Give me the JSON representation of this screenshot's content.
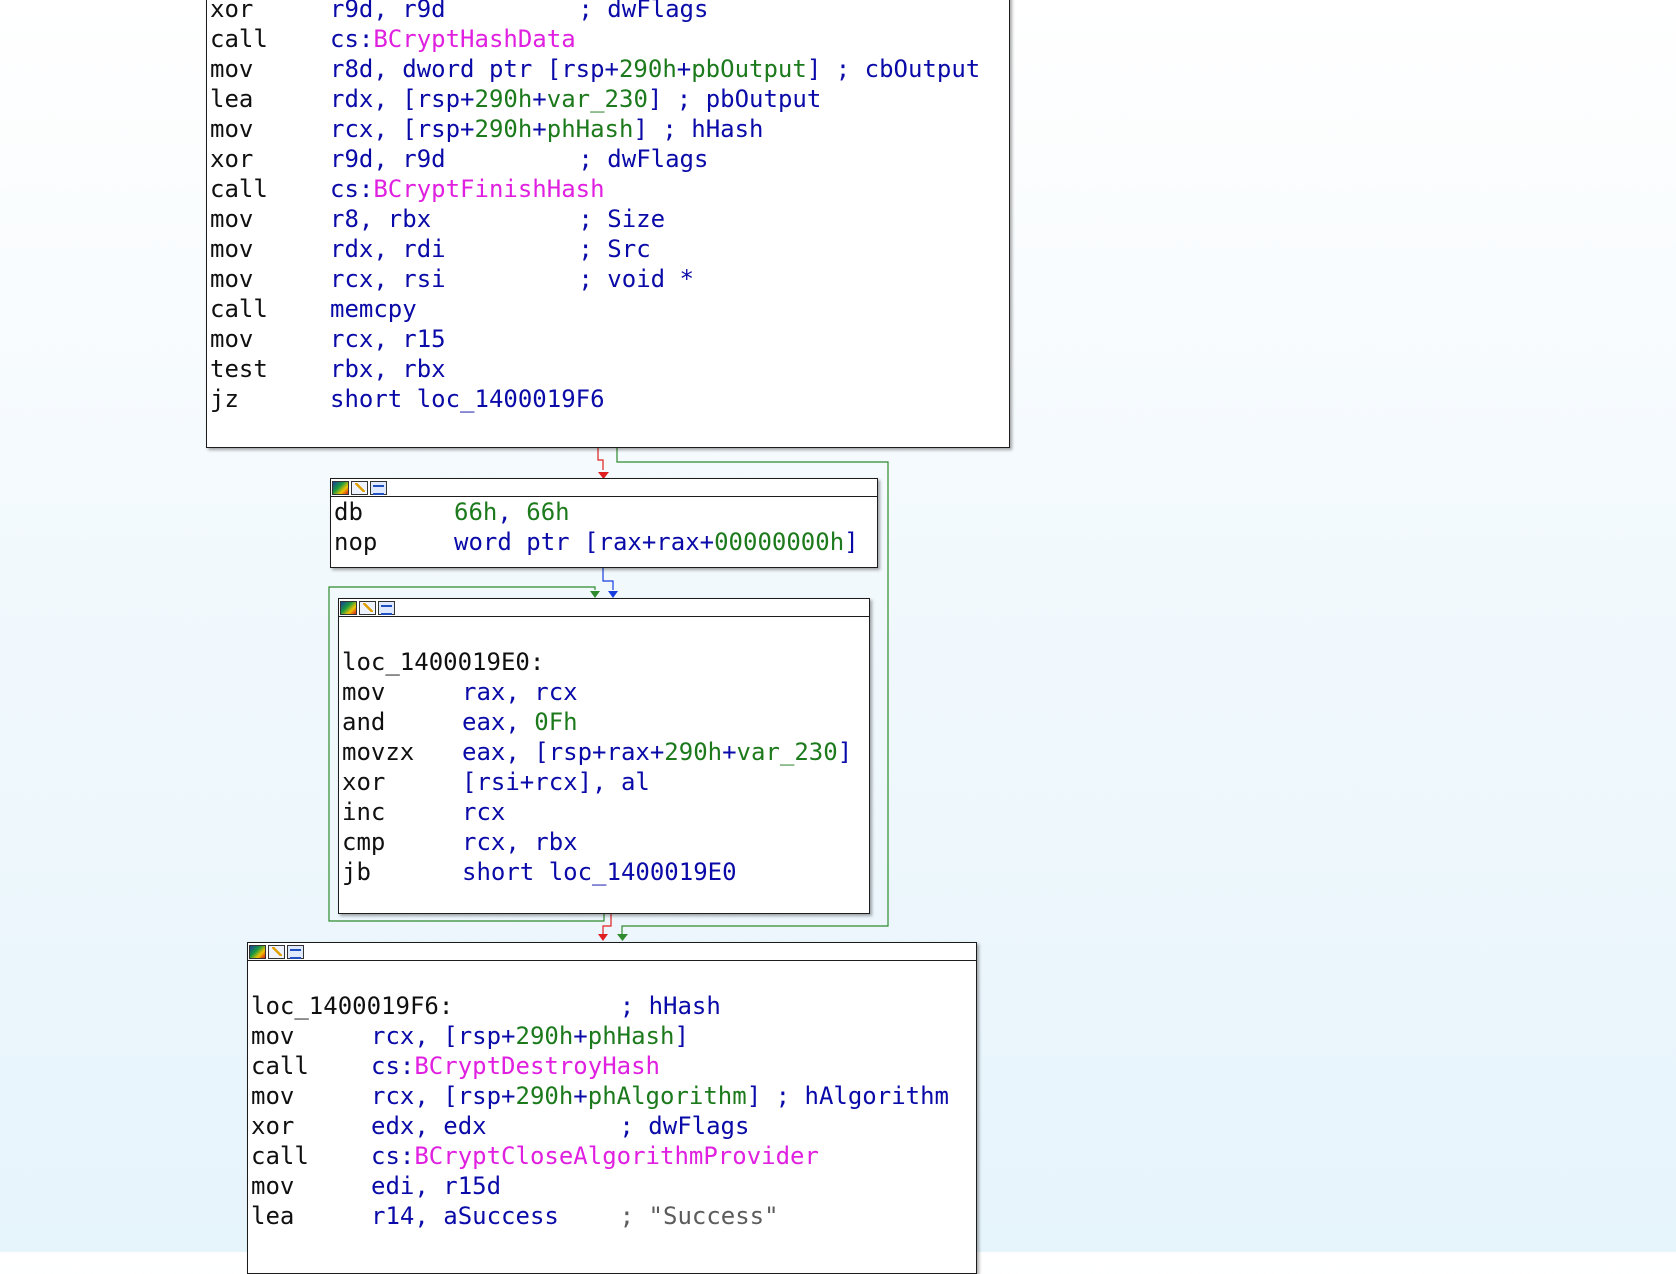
{
  "graph": {
    "edge_colors": {
      "true": "#2e8b2e",
      "false": "#e02020",
      "flow": "#1a3fe0"
    },
    "blocks": [
      {
        "id": "block-hash-finish",
        "title_icons": [],
        "lines": [
          [
            {
              "t": "xor",
              "c": "mn"
            },
            {
              "t": "r9d, r9d",
              "c": "op"
            },
            {
              "t": "; dwFlags",
              "c": "cmt"
            }
          ],
          [
            {
              "t": "call",
              "c": "mn"
            },
            {
              "t": "cs:",
              "c": "op"
            },
            {
              "t": "BCryptHashData",
              "c": "imp"
            }
          ],
          [
            {
              "t": "mov",
              "c": "mn"
            },
            {
              "t": "r8d, dword ptr [rsp+",
              "c": "op"
            },
            {
              "t": "290h",
              "c": "nm"
            },
            {
              "t": "+",
              "c": "op"
            },
            {
              "t": "pbOutput",
              "c": "nm"
            },
            {
              "t": "] ; cbOutput",
              "c": "op"
            }
          ],
          [
            {
              "t": "lea",
              "c": "mn"
            },
            {
              "t": "rdx, [rsp+",
              "c": "op"
            },
            {
              "t": "290h",
              "c": "nm"
            },
            {
              "t": "+",
              "c": "op"
            },
            {
              "t": "var_230",
              "c": "nm"
            },
            {
              "t": "] ; pbOutput",
              "c": "op"
            }
          ],
          [
            {
              "t": "mov",
              "c": "mn"
            },
            {
              "t": "rcx, [rsp+",
              "c": "op"
            },
            {
              "t": "290h",
              "c": "nm"
            },
            {
              "t": "+",
              "c": "op"
            },
            {
              "t": "phHash",
              "c": "nm"
            },
            {
              "t": "] ; hHash",
              "c": "op"
            }
          ],
          [
            {
              "t": "xor",
              "c": "mn"
            },
            {
              "t": "r9d, r9d",
              "c": "op"
            },
            {
              "t": "; dwFlags",
              "c": "cmt"
            }
          ],
          [
            {
              "t": "call",
              "c": "mn"
            },
            {
              "t": "cs:",
              "c": "op"
            },
            {
              "t": "BCryptFinishHash",
              "c": "imp"
            }
          ],
          [
            {
              "t": "mov",
              "c": "mn"
            },
            {
              "t": "r8, rbx",
              "c": "op"
            },
            {
              "t": "; Size",
              "c": "cmt"
            }
          ],
          [
            {
              "t": "mov",
              "c": "mn"
            },
            {
              "t": "rdx, rdi",
              "c": "op"
            },
            {
              "t": "; Src",
              "c": "cmt"
            }
          ],
          [
            {
              "t": "mov",
              "c": "mn"
            },
            {
              "t": "rcx, rsi",
              "c": "op"
            },
            {
              "t": "; void *",
              "c": "cmt"
            }
          ],
          [
            {
              "t": "call",
              "c": "mn"
            },
            {
              "t": "memcpy",
              "c": "lbl"
            }
          ],
          [
            {
              "t": "mov",
              "c": "mn"
            },
            {
              "t": "rcx, r15",
              "c": "op"
            }
          ],
          [
            {
              "t": "test",
              "c": "mn"
            },
            {
              "t": "rbx, rbx",
              "c": "op"
            }
          ],
          [
            {
              "t": "jz",
              "c": "mn"
            },
            {
              "t": "short loc_1400019F6",
              "c": "op"
            }
          ]
        ]
      },
      {
        "id": "block-align",
        "lines": [
          [
            {
              "t": "db",
              "c": "mn"
            },
            {
              "t": "66h",
              "c": "nm"
            },
            {
              "t": ", ",
              "c": "op"
            },
            {
              "t": "66h",
              "c": "nm"
            }
          ],
          [
            {
              "t": "nop",
              "c": "mn"
            },
            {
              "t": "word ptr [rax+rax+",
              "c": "op"
            },
            {
              "t": "00000000h",
              "c": "nm"
            },
            {
              "t": "]",
              "c": "op"
            }
          ]
        ]
      },
      {
        "id": "block-loop",
        "label": "loc_1400019E0:",
        "lines": [
          [
            {
              "t": "mov",
              "c": "mn"
            },
            {
              "t": "rax, rcx",
              "c": "op"
            }
          ],
          [
            {
              "t": "and",
              "c": "mn"
            },
            {
              "t": "eax, ",
              "c": "op"
            },
            {
              "t": "0Fh",
              "c": "nm"
            }
          ],
          [
            {
              "t": "movzx",
              "c": "mn"
            },
            {
              "t": "eax, [rsp+rax+",
              "c": "op"
            },
            {
              "t": "290h",
              "c": "nm"
            },
            {
              "t": "+",
              "c": "op"
            },
            {
              "t": "var_230",
              "c": "nm"
            },
            {
              "t": "]",
              "c": "op"
            }
          ],
          [
            {
              "t": "xor",
              "c": "mn"
            },
            {
              "t": "[rsi+rcx], al",
              "c": "op"
            }
          ],
          [
            {
              "t": "inc",
              "c": "mn"
            },
            {
              "t": "rcx",
              "c": "op"
            }
          ],
          [
            {
              "t": "cmp",
              "c": "mn"
            },
            {
              "t": "rcx, rbx",
              "c": "op"
            }
          ],
          [
            {
              "t": "jb",
              "c": "mn"
            },
            {
              "t": "short loc_1400019E0",
              "c": "op"
            }
          ]
        ]
      },
      {
        "id": "block-cleanup",
        "label": "loc_1400019F6:",
        "label_comment": "; hHash",
        "lines": [
          [
            {
              "t": "mov",
              "c": "mn"
            },
            {
              "t": "rcx, [rsp+",
              "c": "op"
            },
            {
              "t": "290h",
              "c": "nm"
            },
            {
              "t": "+",
              "c": "op"
            },
            {
              "t": "phHash",
              "c": "nm"
            },
            {
              "t": "]",
              "c": "op"
            }
          ],
          [
            {
              "t": "call",
              "c": "mn"
            },
            {
              "t": "cs:",
              "c": "op"
            },
            {
              "t": "BCryptDestroyHash",
              "c": "imp"
            }
          ],
          [
            {
              "t": "mov",
              "c": "mn"
            },
            {
              "t": "rcx, [rsp+",
              "c": "op"
            },
            {
              "t": "290h",
              "c": "nm"
            },
            {
              "t": "+",
              "c": "op"
            },
            {
              "t": "phAlgorithm",
              "c": "nm"
            },
            {
              "t": "] ; hAlgorithm",
              "c": "op"
            }
          ],
          [
            {
              "t": "xor",
              "c": "mn"
            },
            {
              "t": "edx, edx",
              "c": "op"
            },
            {
              "t": "; dwFlags",
              "c": "cmt"
            }
          ],
          [
            {
              "t": "call",
              "c": "mn"
            },
            {
              "t": "cs:",
              "c": "op"
            },
            {
              "t": "BCryptCloseAlgorithmProvider",
              "c": "imp"
            }
          ],
          [
            {
              "t": "mov",
              "c": "mn"
            },
            {
              "t": "edi, r15d",
              "c": "op"
            }
          ],
          [
            {
              "t": "lea",
              "c": "mn"
            },
            {
              "t": "r14, aSuccess",
              "c": "op"
            },
            {
              "t": "; \"Success\"",
              "c": "str"
            }
          ]
        ]
      }
    ]
  }
}
